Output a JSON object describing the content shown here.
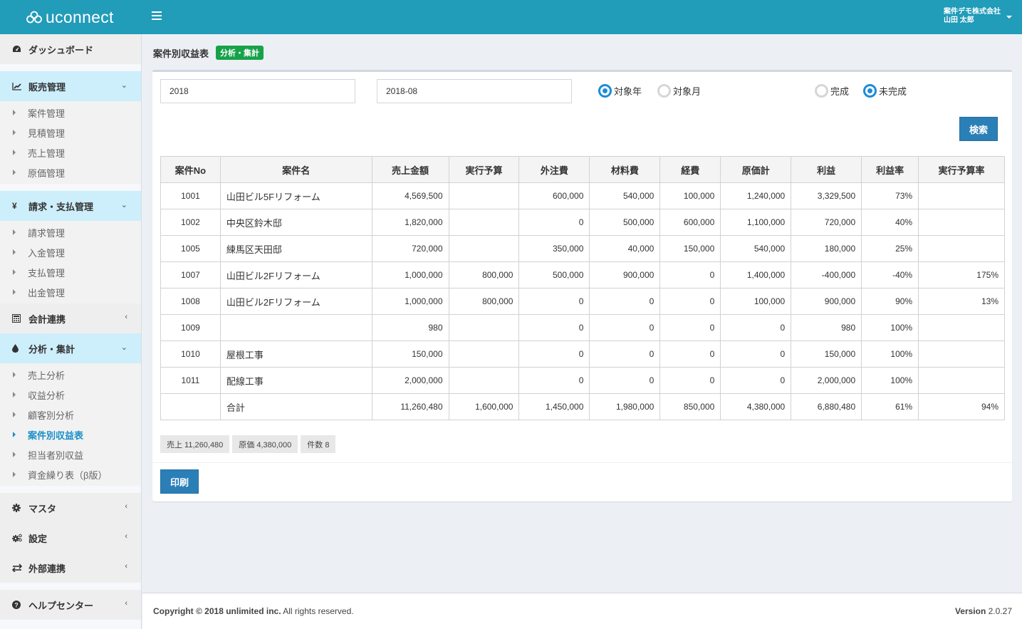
{
  "header": {
    "brand": "uconnect",
    "company": "案件デモ株式会社",
    "user": "山田 太郎"
  },
  "sidebar": {
    "dashboard": {
      "label": "ダッシュボード",
      "icon": "dashboard-icon"
    },
    "sections": [
      {
        "label": "販売管理",
        "icon": "line-chart-icon",
        "state": "open",
        "items": [
          {
            "label": "案件管理"
          },
          {
            "label": "見積管理"
          },
          {
            "label": "売上管理"
          },
          {
            "label": "原価管理"
          }
        ]
      },
      {
        "label": "請求・支払管理",
        "icon": "yen-icon",
        "state": "open",
        "items": [
          {
            "label": "請求管理"
          },
          {
            "label": "入金管理"
          },
          {
            "label": "支払管理"
          },
          {
            "label": "出金管理"
          }
        ]
      },
      {
        "label": "会計連携",
        "icon": "calculator-icon",
        "state": "closed"
      },
      {
        "label": "分析・集計",
        "icon": "tint-icon",
        "state": "open",
        "items": [
          {
            "label": "売上分析"
          },
          {
            "label": "収益分析"
          },
          {
            "label": "顧客別分析"
          },
          {
            "label": "案件別収益表",
            "active": true
          },
          {
            "label": "担当者別収益"
          },
          {
            "label": "資金繰り表（β版）"
          }
        ]
      },
      {
        "label": "マスタ",
        "icon": "gear-icon",
        "state": "closed"
      },
      {
        "label": "設定",
        "icon": "gears-icon",
        "state": "closed"
      },
      {
        "label": "外部連携",
        "icon": "exchange-icon",
        "state": "closed"
      },
      {
        "label": "ヘルプセンター",
        "icon": "question-circle-icon",
        "state": "closed"
      }
    ]
  },
  "page": {
    "title": "案件別収益表",
    "badge": "分析・集計"
  },
  "filters": {
    "year_value": "2018",
    "month_value": "2018-08",
    "period_options": [
      {
        "label": "対象年",
        "checked": true
      },
      {
        "label": "対象月",
        "checked": false
      }
    ],
    "status_options": [
      {
        "label": "完成",
        "checked": false
      },
      {
        "label": "未完成",
        "checked": true
      }
    ],
    "search_label": "検索"
  },
  "table": {
    "columns": [
      "案件No",
      "案件名",
      "売上金額",
      "実行予算",
      "外注費",
      "材料費",
      "経費",
      "原価計",
      "利益",
      "利益率",
      "実行予算率"
    ],
    "rows": [
      [
        "1001",
        "山田ビル5Fリフォーム",
        "4,569,500",
        "",
        "600,000",
        "540,000",
        "100,000",
        "1,240,000",
        "3,329,500",
        "73%",
        ""
      ],
      [
        "1002",
        "中央区鈴木邸",
        "1,820,000",
        "",
        "0",
        "500,000",
        "600,000",
        "1,100,000",
        "720,000",
        "40%",
        ""
      ],
      [
        "1005",
        "練馬区天田邸",
        "720,000",
        "",
        "350,000",
        "40,000",
        "150,000",
        "540,000",
        "180,000",
        "25%",
        ""
      ],
      [
        "1007",
        "山田ビル2Fリフォーム",
        "1,000,000",
        "800,000",
        "500,000",
        "900,000",
        "0",
        "1,400,000",
        "-400,000",
        "-40%",
        "175%"
      ],
      [
        "1008",
        "山田ビル2Fリフォーム",
        "1,000,000",
        "800,000",
        "0",
        "0",
        "0",
        "100,000",
        "900,000",
        "90%",
        "13%"
      ],
      [
        "1009",
        "",
        "980",
        "",
        "0",
        "0",
        "0",
        "0",
        "980",
        "100%",
        ""
      ],
      [
        "1010",
        "屋根工事",
        "150,000",
        "",
        "0",
        "0",
        "0",
        "0",
        "150,000",
        "100%",
        ""
      ],
      [
        "1011",
        "配線工事",
        "2,000,000",
        "",
        "0",
        "0",
        "0",
        "0",
        "2,000,000",
        "100%",
        ""
      ]
    ],
    "total": [
      "",
      "合計",
      "11,260,480",
      "1,600,000",
      "1,450,000",
      "1,980,000",
      "850,000",
      "4,380,000",
      "6,880,480",
      "61%",
      "94%"
    ]
  },
  "stats": [
    "売上 11,260,480",
    "原価 4,380,000",
    "件数 8"
  ],
  "print_label": "印刷",
  "footer": {
    "copyright_bold": "Copyright © 2018 unlimited inc.",
    "copyright_rest": " All rights reserved.",
    "version_label": "Version",
    "version_value": " 2.0.27"
  },
  "colors": {
    "header": "#219cb9",
    "accent_blue": "#2b7fb7",
    "badge_green": "#17a24a",
    "active_nav": "#1a8fc7",
    "section_open_bg": "#cdeefb"
  }
}
